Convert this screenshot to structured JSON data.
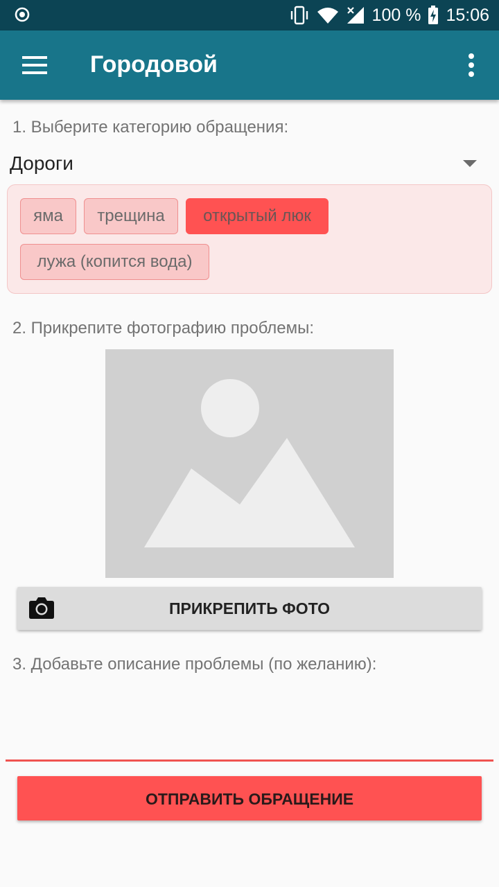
{
  "status_bar": {
    "battery": "100 %",
    "time": "15:06"
  },
  "app_bar": {
    "title": "Городовой"
  },
  "step1": {
    "label": "1. Выберите категорию обращения:",
    "category": "Дороги",
    "tags": [
      {
        "label": "яма",
        "selected": false
      },
      {
        "label": "трещина",
        "selected": false
      },
      {
        "label": "открытый люк",
        "selected": true
      },
      {
        "label": "лужа (копится вода)",
        "selected": false
      }
    ]
  },
  "step2": {
    "label": "2. Прикрепите фотографию проблемы:",
    "button": "ПРИКРЕПИТЬ ФОТО"
  },
  "step3": {
    "label": "3. Добавьте описание проблемы (по желанию):",
    "value": ""
  },
  "submit": {
    "label": "ОТПРАВИТЬ ОБРАЩЕНИЕ"
  },
  "colors": {
    "status_bar": "#0c4454",
    "app_bar": "#18758a",
    "accent": "#ff5252",
    "tag_bg": "#f9c8c8"
  }
}
